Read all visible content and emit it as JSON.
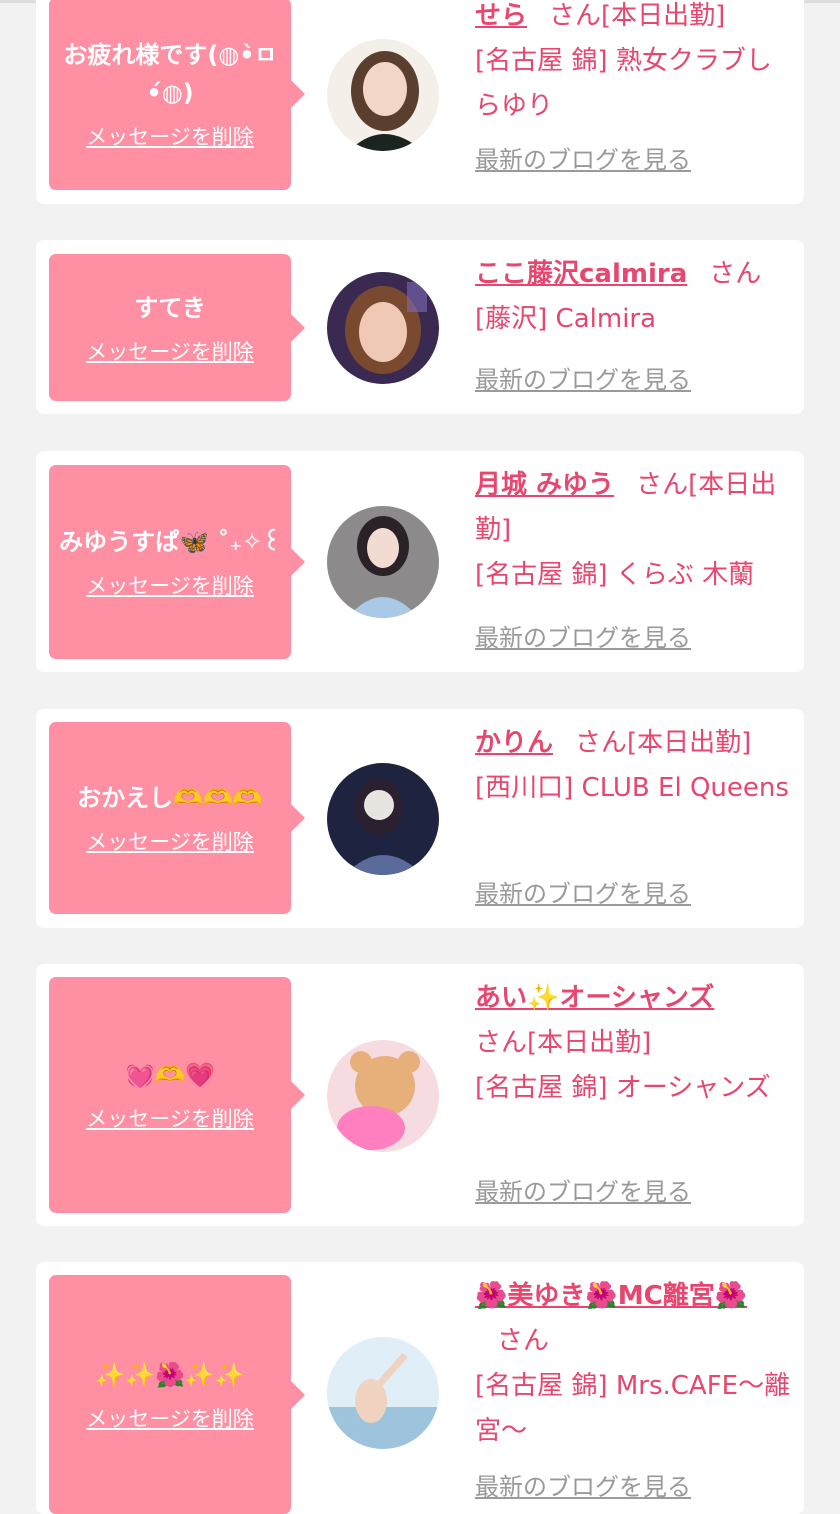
{
  "accent": "#ff8fa3",
  "name_color": "#e8466e",
  "delete_label": "メッセージを削除",
  "blog_label": "最新のブログを見る",
  "entries": [
    {
      "message": "お疲れ様です(◍•̀ㅁ•́◍)",
      "name": "せら",
      "suffix": "さん[本日出勤]",
      "shop": "[名古屋 錦] 熟女クラブしらゆり",
      "avatar": "woman-photo"
    },
    {
      "message": "すてき",
      "name": "ここ藤沢calmira",
      "suffix": "さん",
      "shop": "[藤沢] Calmira",
      "avatar": "woman-photo"
    },
    {
      "message": "みゆうすぱ🦋 ˚₊✧꒰",
      "name": "月城 みゆう",
      "suffix": "さん[本日出勤]",
      "shop": "[名古屋 錦] くらぶ 木蘭",
      "avatar": "woman-photo"
    },
    {
      "message": "おかえし🫶🫶🫶",
      "name": "かりん",
      "suffix": "さん[本日出勤]",
      "shop": "[西川口] CLUB El Queens",
      "avatar": "woman-photo"
    },
    {
      "message": "💓🫶💗",
      "name": "あい✨オーシャンズ",
      "suffix": "さん[本日出勤]",
      "shop": "[名古屋 錦] オーシャンズ",
      "avatar": "teddy-bear-illustration"
    },
    {
      "message": "✨✨🌺✨✨",
      "name": "🌺美ゆき🌺MC離宮🌺",
      "suffix": "さん",
      "shop": "[名古屋 錦] Mrs.CAFE〜離宮〜",
      "avatar": "beach-photo"
    }
  ]
}
